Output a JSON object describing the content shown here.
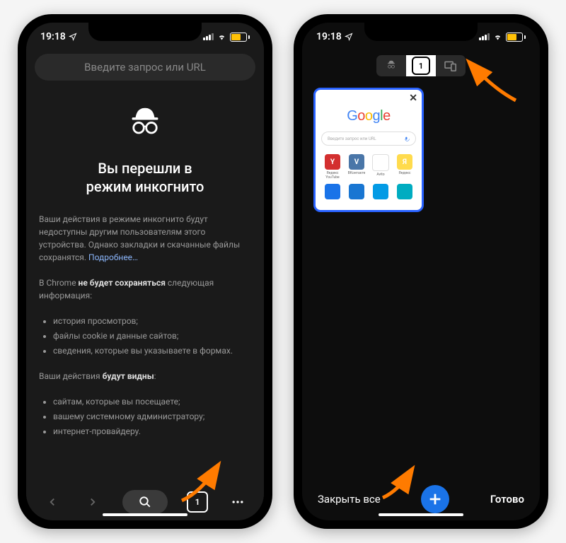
{
  "status": {
    "time": "19:18"
  },
  "phone1": {
    "urlPlaceholder": "Введите запрос или URL",
    "incognito": {
      "title_l1": "Вы перешли в",
      "title_l2": "режим инкогнито",
      "para1": "Ваши действия в режиме инкогнито будут недоступны другим пользователям этого устройства. Однако закладки и скачанные файлы сохранятся.",
      "moreLink": "Подробнее…",
      "para2_pre": "В Chrome ",
      "para2_bold": "не будет сохраняться",
      "para2_post": " следующая информация:",
      "notSaved": [
        "история просмотров;",
        "файлы cookie и данные сайтов;",
        "сведения, которые вы указываете в формах."
      ],
      "para3_pre": "Ваши действия ",
      "para3_bold": "будут видны",
      "para3_post": ":",
      "visible": [
        "сайтам, которые вы посещаете;",
        "вашему системному администратору;",
        "интернет-провайдеру."
      ]
    },
    "bottomBar": {
      "tabsCount": "1"
    }
  },
  "phone2": {
    "switcher": {
      "tabCount": "1"
    },
    "tabCard": {
      "googleLetters": [
        "G",
        "o",
        "o",
        "g",
        "l",
        "e"
      ],
      "googleColors": [
        "#4285F4",
        "#EA4335",
        "#FBBC05",
        "#4285F4",
        "#34A853",
        "#EA4335"
      ],
      "searchPlaceholder": "Введите запрос или URL",
      "tiles": [
        {
          "label": "Яндекс YouTube",
          "bg": "#d32f2f",
          "txt": "Y"
        },
        {
          "label": "ВКонтакте",
          "bg": "#4a76a8",
          "txt": "V"
        },
        {
          "label": "Avito",
          "bg": "#fff",
          "txt": ""
        },
        {
          "label": "Яндекс",
          "bg": "#ffdb4d",
          "txt": "Я"
        }
      ]
    },
    "bottomBar": {
      "closeAll": "Закрыть все",
      "done": "Готово"
    }
  }
}
